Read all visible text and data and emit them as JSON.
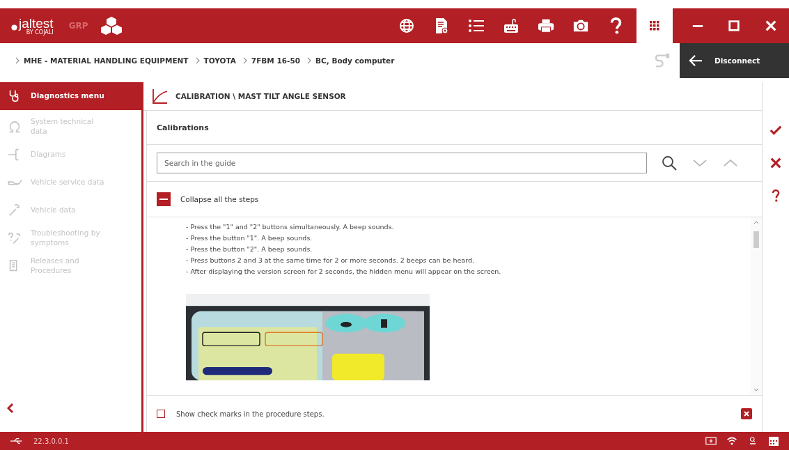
{
  "app_bar": {
    "logo": "jaltest",
    "logo_sub": "BY COJALI",
    "mode": "GRP"
  },
  "breadcrumb": [
    "MHE - MATERIAL HANDLING EQUIPMENT",
    "TOYOTA",
    "7FBM 16-50",
    "BC, Body computer"
  ],
  "disconnect": {
    "label": "Disconnect"
  },
  "sidebar": {
    "items": [
      {
        "label": "Diagnostics menu",
        "selected": true,
        "disabled": false
      },
      {
        "label": "System technical data",
        "selected": false,
        "disabled": true
      },
      {
        "label": "Diagrams",
        "selected": false,
        "disabled": true
      },
      {
        "label": "Vehicle service data",
        "selected": false,
        "disabled": true
      },
      {
        "label": "Vehicle data",
        "selected": false,
        "disabled": true
      },
      {
        "label": "Troubleshooting by symptoms",
        "selected": false,
        "disabled": true
      },
      {
        "label": "Releases and Procedures",
        "selected": false,
        "disabled": true
      }
    ]
  },
  "page_title": "CALIBRATION \\ MAST TILT ANGLE SENSOR",
  "section_title": "Calibrations",
  "search": {
    "placeholder": "Search in the guide"
  },
  "collapse": {
    "label": "Collapse all the steps",
    "expanded": true
  },
  "steps": [
    "- Press the \"1\" and \"2\" buttons simultaneously. A beep sounds.",
    "- Press the button \"1\". A beep sounds.",
    "- Press the button \"2\". A beep sounds.",
    "- Press buttons 2 and 3 at the same time for 2 or more seconds. 2 beeps can be heard.",
    "- After displaying the version screen for 2 seconds, the hidden menu will appear on the screen."
  ],
  "guide_image": {
    "kind": "picture"
  },
  "show_check_marks": {
    "label": "Show check marks in the procedure steps.",
    "checked": false
  },
  "status_bar": {
    "version": "22.3.0.0.1"
  }
}
